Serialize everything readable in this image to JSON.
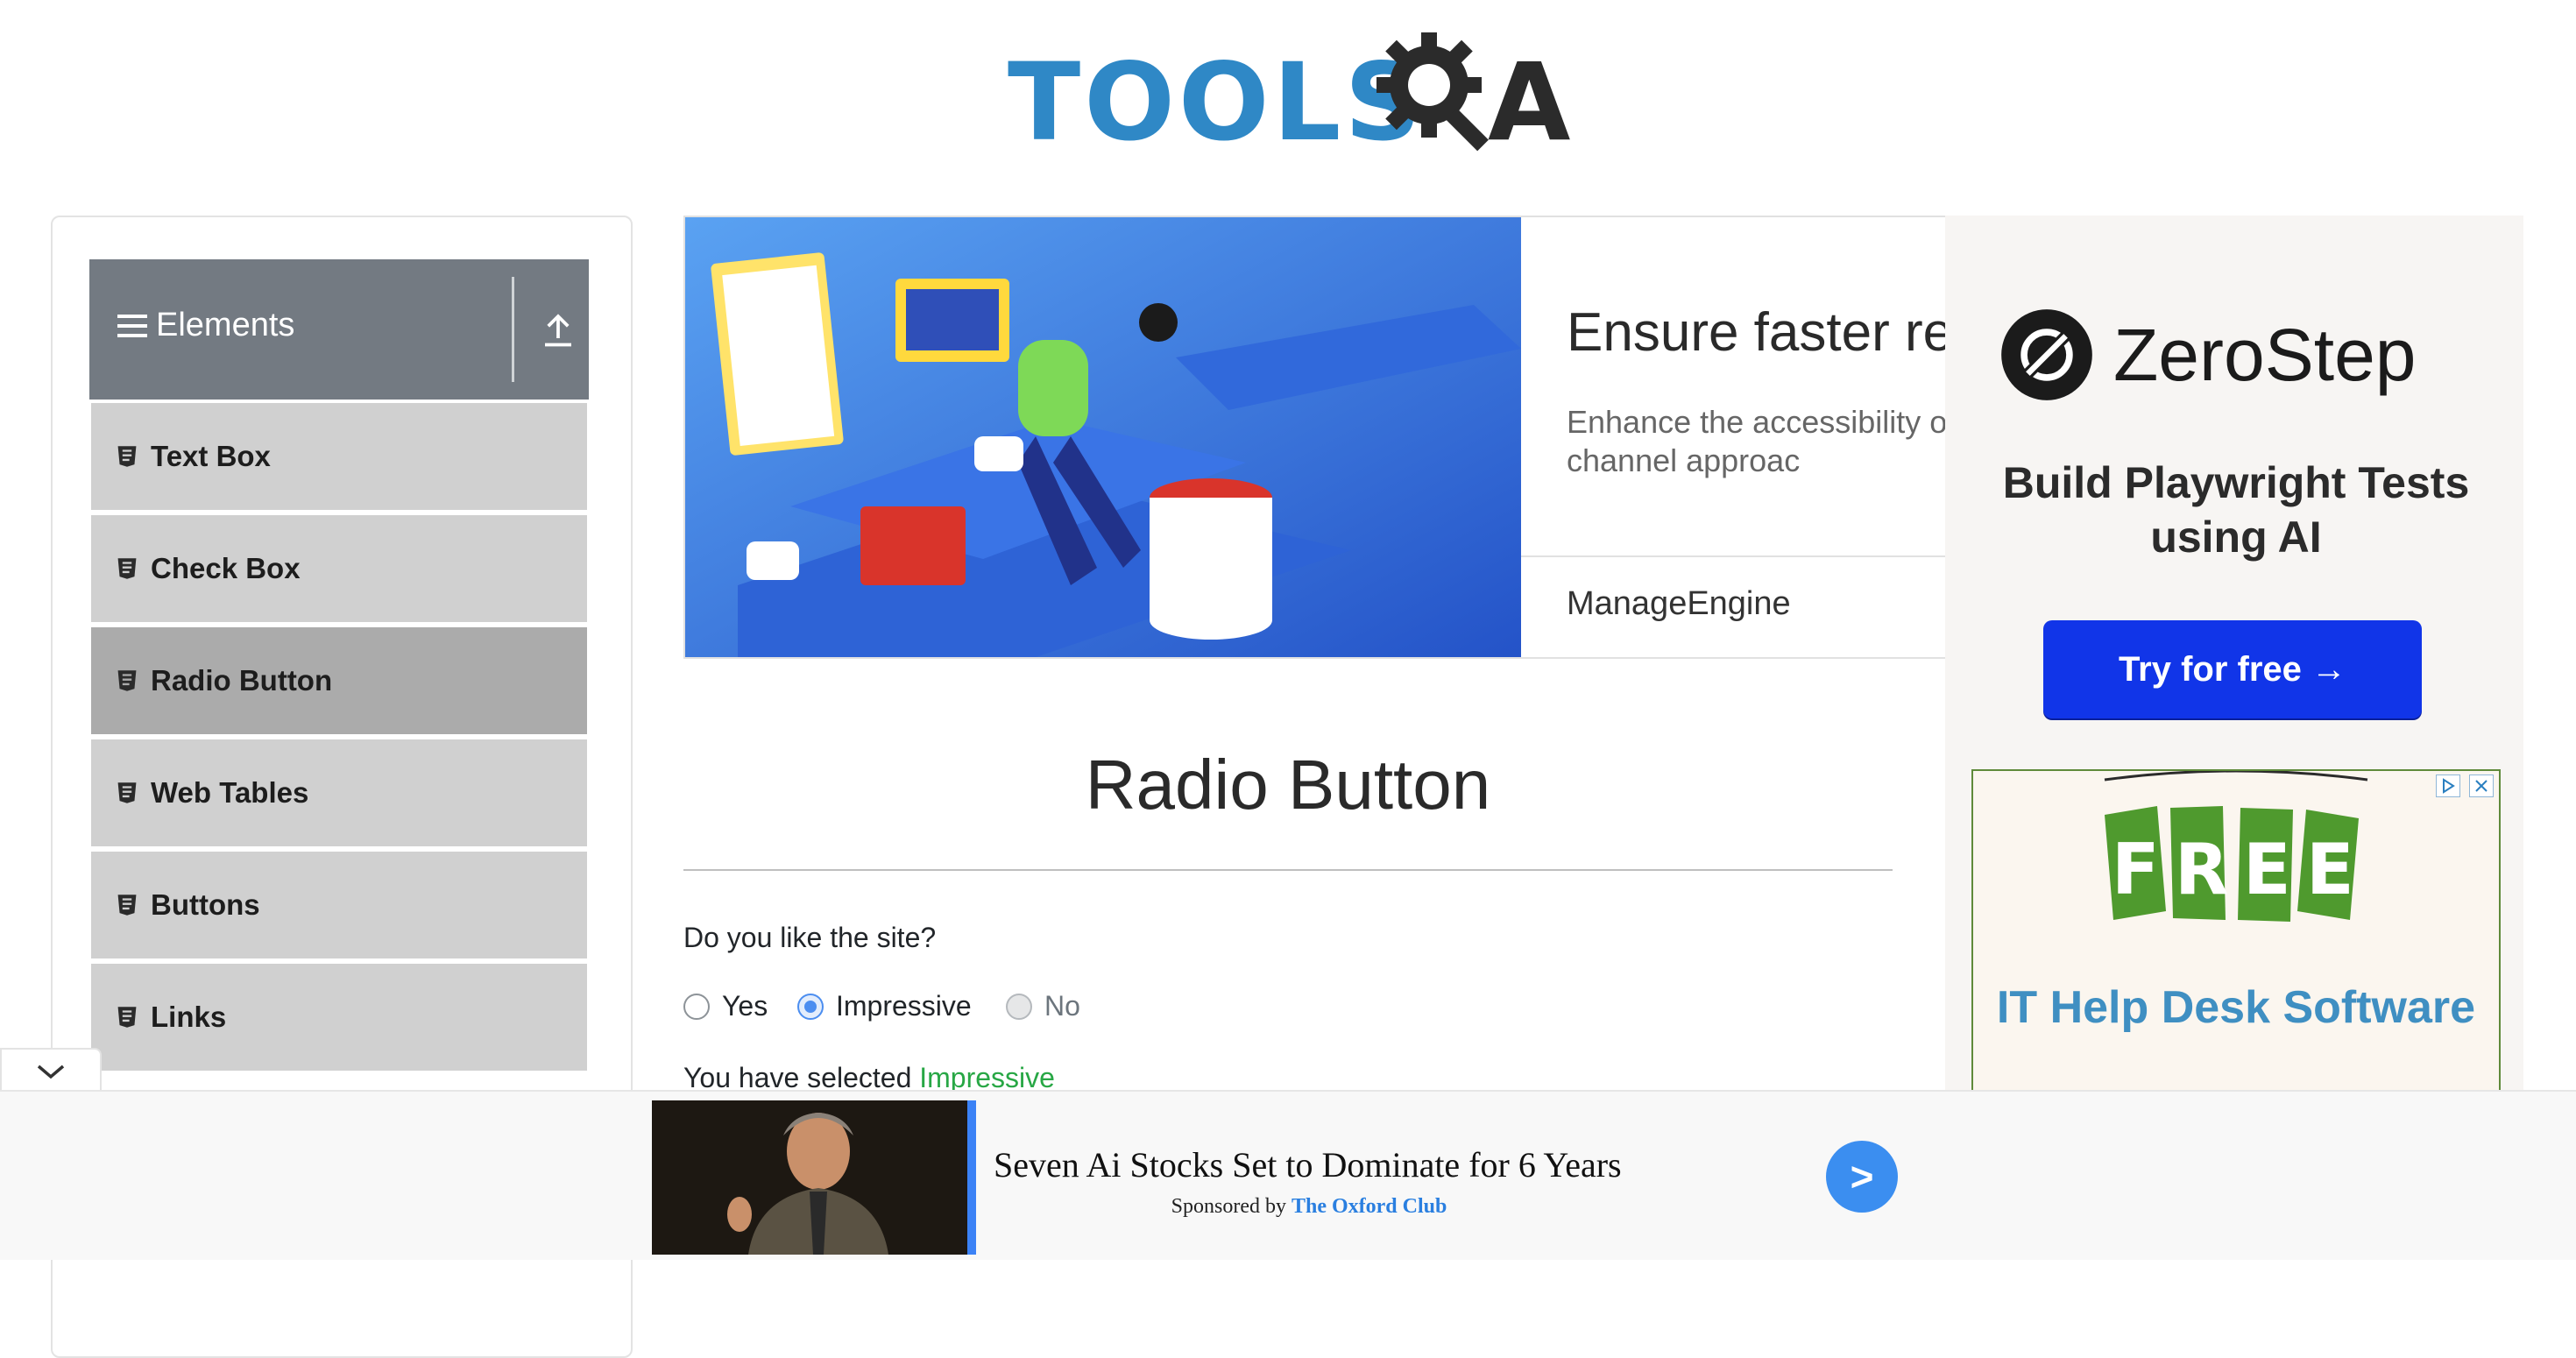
{
  "header": {
    "logo_text": "TOOLSQA"
  },
  "sidebar": {
    "group_title": "Elements",
    "items": [
      {
        "label": "Text Box"
      },
      {
        "label": "Check Box"
      },
      {
        "label": "Radio Button",
        "active": true
      },
      {
        "label": "Web Tables"
      },
      {
        "label": "Buttons"
      },
      {
        "label": "Links"
      }
    ]
  },
  "banner_ad": {
    "headline": "Ensure faster res",
    "body": "Enhance the accessibility o our omni-channel approac",
    "brand": "ManageEngine"
  },
  "right_ad": {
    "brand": "ZeroStep",
    "tagline": "Build Playwright Tests using AI",
    "cta": "Try for free →",
    "second_ad_badge": "FREE",
    "second_ad_title": "IT Help Desk Software"
  },
  "main": {
    "title": "Radio Button",
    "question": "Do you like the site?",
    "options": [
      {
        "label": "Yes",
        "state": "unchecked"
      },
      {
        "label": "Impressive",
        "state": "checked"
      },
      {
        "label": "No",
        "state": "disabled"
      }
    ],
    "result_prefix": "You have selected ",
    "result_value": "Impressive"
  },
  "bottom_ad": {
    "headline": "Seven Ai Stocks Set to Dominate for 6 Years",
    "sponsored_prefix": "Sponsored by ",
    "sponsor": "The Oxford Club",
    "go": ">"
  },
  "colors": {
    "logo_blue": "#2f88c6",
    "sidebar_header": "#737a82",
    "menu_item": "#d0d0d0",
    "menu_item_active": "#ababab",
    "radio_accent": "#4c8ef0",
    "success_green": "#28a745",
    "cta_blue": "#1135e8"
  }
}
